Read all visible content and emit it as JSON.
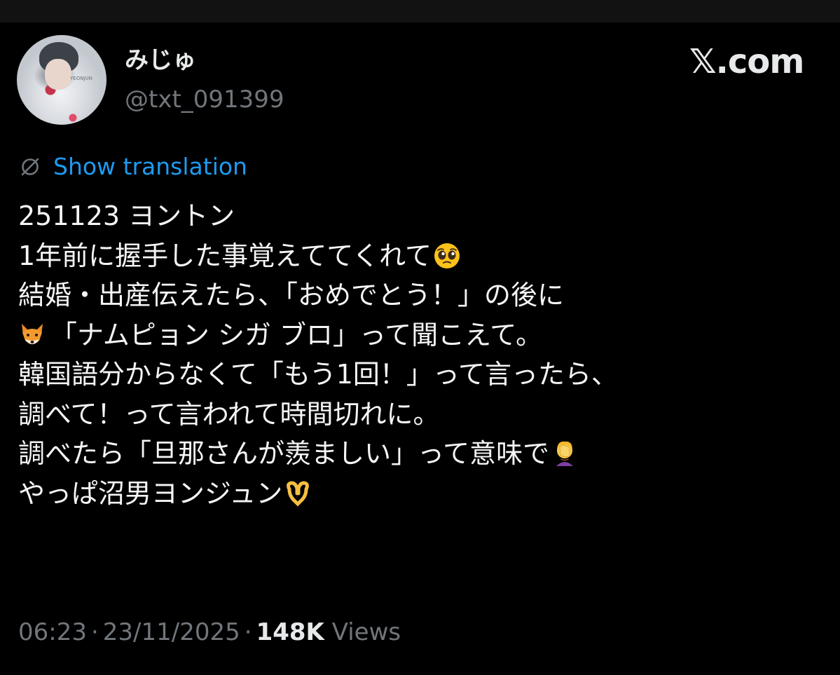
{
  "author": {
    "display_name": "みじゅ",
    "handle": "@txt_091399",
    "avatar_icon": "profile-photo",
    "avatar_shirt_text": "YEONJUN"
  },
  "brand": {
    "label": "𝕏.com"
  },
  "translation": {
    "icon": "globe-slash-icon",
    "label": "Show translation",
    "link_color": "#1d9bf0"
  },
  "tweet": {
    "lines": [
      {
        "text": "251123 ヨントン"
      },
      {
        "text": "1年前に握手した事覚えててくれて",
        "emoji_after": "pleading-face-icon"
      },
      {
        "text": "結婚・出産伝えたら、「おめでとう！」の後に"
      },
      {
        "emoji_before": "fox-face-icon",
        "text": "「ナムピョン シガ ブロ」って聞こえて。"
      },
      {
        "text": "韓国語分からなくて「もう1回！」って言ったら、"
      },
      {
        "text": "調べて！って言われて時間切れに。"
      },
      {
        "text": "調べたら「旦那さんが羨ましい」って意味で",
        "emoji_after": "face-palm-icon"
      },
      {
        "text": "やっぱ沼男ヨンジュン",
        "emoji_after": "heart-hands-icon"
      }
    ]
  },
  "meta": {
    "time": "06:23",
    "date": "23/11/2025",
    "separator": "·",
    "views_count": "148K",
    "views_label": "Views"
  },
  "colors": {
    "background": "#000000",
    "primary_text": "#e7e9ea",
    "secondary_text": "#71767b",
    "accent": "#1d9bf0"
  }
}
